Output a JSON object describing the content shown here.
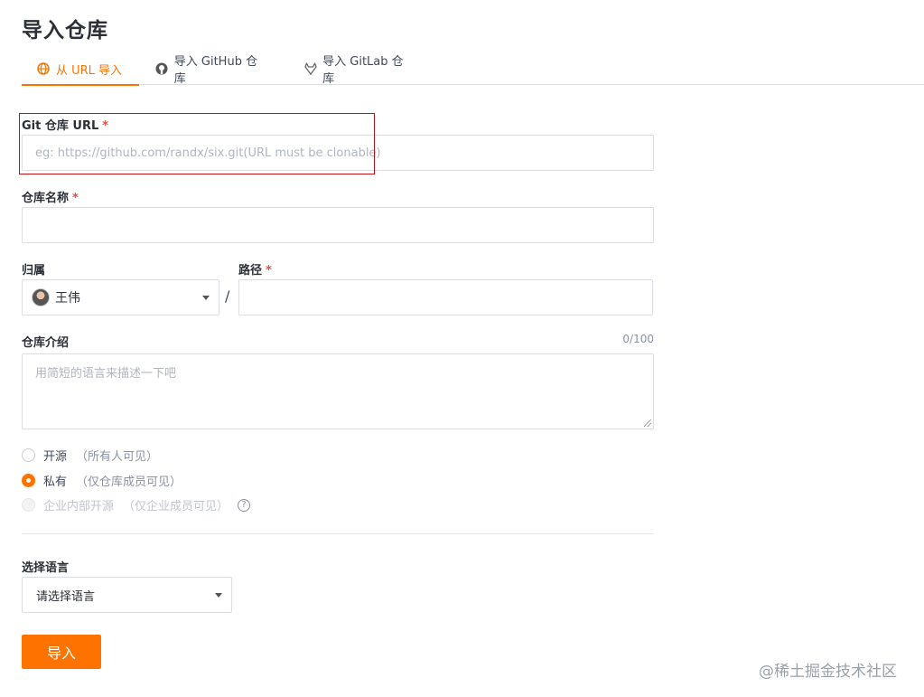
{
  "page": {
    "title": "导入仓库"
  },
  "tabs": [
    {
      "label": "从 URL 导入",
      "icon": "globe-icon",
      "active": true
    },
    {
      "label": "导入 GitHub 仓库",
      "icon": "github-icon",
      "active": false
    },
    {
      "label": "导入 GitLab 仓库",
      "icon": "gitlab-icon",
      "active": false
    }
  ],
  "form": {
    "git_url": {
      "label": "Git 仓库 URL",
      "required_mark": "*",
      "placeholder": "eg: https://github.com/randx/six.git(URL must be clonable)"
    },
    "repo_name": {
      "label": "仓库名称",
      "required_mark": "*",
      "value": ""
    },
    "owner": {
      "label": "归属",
      "value": "王伟"
    },
    "path_separator": "/",
    "path": {
      "label": "路径",
      "required_mark": "*",
      "value": ""
    },
    "description": {
      "label": "仓库介绍",
      "counter": "0/100",
      "placeholder": "用简短的语言来描述一下吧"
    },
    "visibility": [
      {
        "label": "开源",
        "note": "（所有人可见）",
        "checked": false,
        "disabled": false
      },
      {
        "label": "私有",
        "note": "（仅仓库成员可见）",
        "checked": true,
        "disabled": false
      },
      {
        "label": "企业内部开源",
        "note": "（仅企业成员可见）",
        "checked": false,
        "disabled": true
      }
    ],
    "language": {
      "label": "选择语言",
      "value": "请选择语言"
    },
    "submit_label": "导入"
  },
  "watermark": "@稀土掘金技术社区",
  "colors": {
    "accent": "#fe7300",
    "annotation": "#c0121b"
  }
}
